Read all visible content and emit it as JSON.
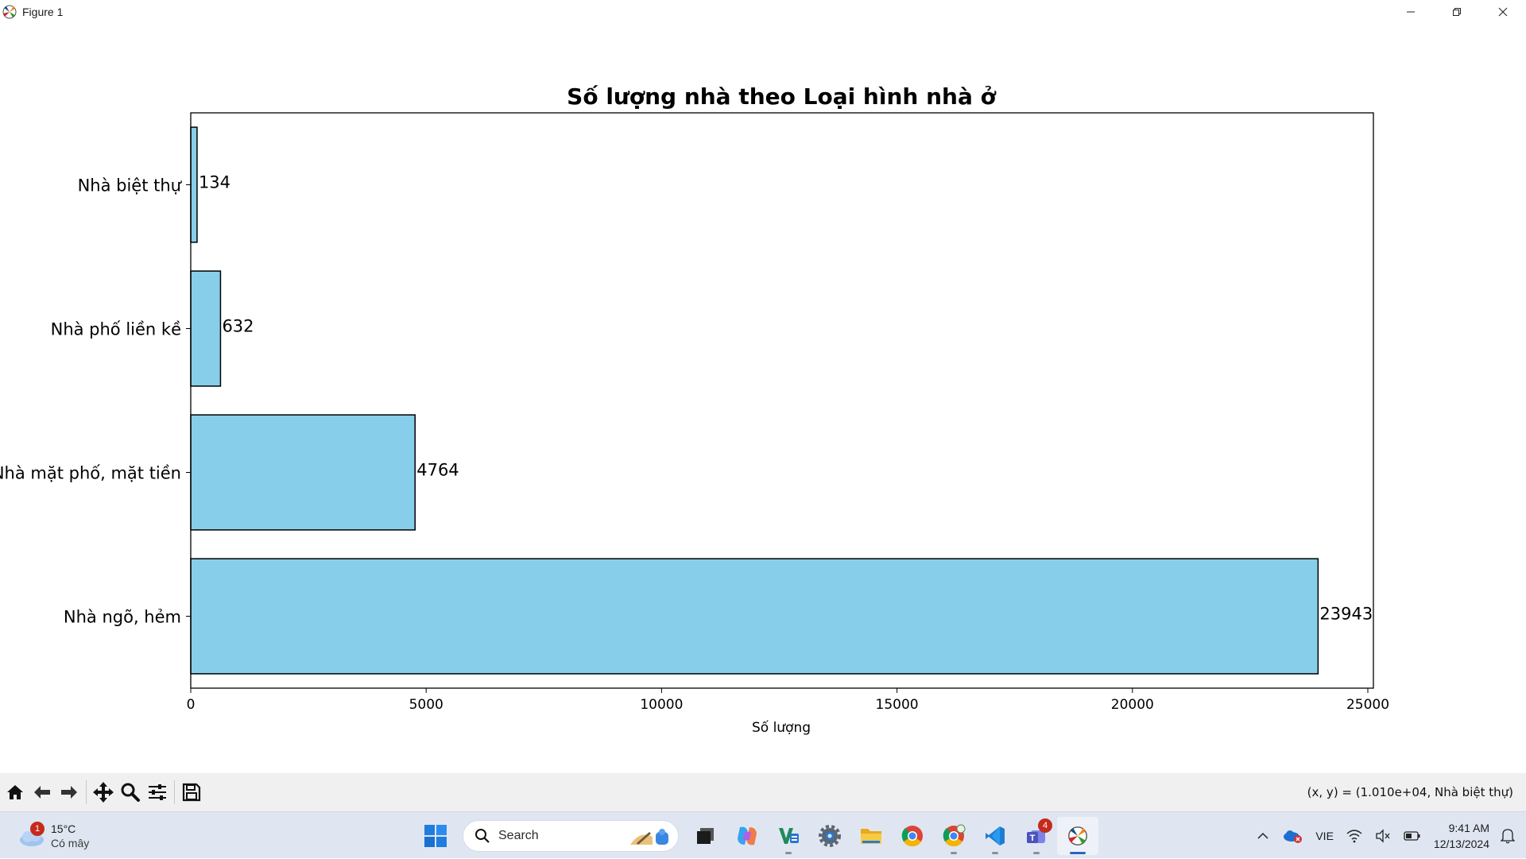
{
  "window": {
    "title": "Figure 1",
    "icons": {
      "app": "matplotlib-icon",
      "minimize": "minimize-icon",
      "restore": "restore-icon",
      "close": "close-icon"
    }
  },
  "chart_data": {
    "type": "bar",
    "orientation": "horizontal",
    "title": "Số lượng nhà theo Loại hình nhà ở",
    "xlabel": "Số lượng",
    "ylabel": "",
    "categories": [
      "Nhà ngõ, hẻm",
      "Nhà mặt phố, mặt tiền",
      "Nhà phố liền kề",
      "Nhà biệt thự"
    ],
    "values": [
      23943,
      4764,
      632,
      134
    ],
    "data_labels": [
      "23943",
      "4764",
      "632",
      "134"
    ],
    "xlim": [
      0,
      25000
    ],
    "xticks": [
      0,
      5000,
      10000,
      15000,
      20000,
      25000
    ],
    "xtick_labels": [
      "0",
      "5000",
      "10000",
      "15000",
      "20000",
      "25000"
    ],
    "bar_color": "#87ceeb",
    "edge_color": "#000000",
    "grid": false,
    "legend": "none"
  },
  "toolbar": {
    "tools": [
      {
        "name": "home-icon",
        "interactable": true
      },
      {
        "name": "back-icon",
        "interactable": true
      },
      {
        "name": "forward-icon",
        "interactable": true
      },
      {
        "name": "pan-icon",
        "interactable": true
      },
      {
        "name": "zoom-icon",
        "interactable": true
      },
      {
        "name": "configure-subplots-icon",
        "interactable": true
      },
      {
        "name": "save-icon",
        "interactable": true
      }
    ],
    "coords": "(x, y) = (1.010e+04, Nhà biệt thự)"
  },
  "taskbar": {
    "weather": {
      "temp": "15°C",
      "condition": "Có mây",
      "badge": "1"
    },
    "search_placeholder": "Search",
    "apps": [
      {
        "name": "start-icon"
      },
      {
        "name": "task-view-icon"
      },
      {
        "name": "copilot-icon"
      },
      {
        "name": "vs-app-icon"
      },
      {
        "name": "settings-icon"
      },
      {
        "name": "file-explorer-icon"
      },
      {
        "name": "chrome-icon"
      },
      {
        "name": "chrome-profile-icon"
      },
      {
        "name": "vscode-icon"
      },
      {
        "name": "teams-icon",
        "badge": "4"
      },
      {
        "name": "matplotlib-taskbar-icon"
      }
    ],
    "tray": {
      "language": "VIE",
      "time": "9:41 AM",
      "date": "12/13/2024"
    }
  }
}
